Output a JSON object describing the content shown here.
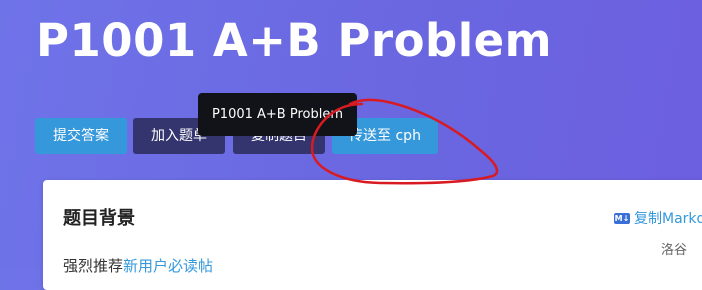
{
  "title": "P1001 A+B Problem",
  "buttons": {
    "submit": "提交答案",
    "add_to_list": "加入题单",
    "copy": "复制题目",
    "send_cph": "传送至 cph"
  },
  "tooltip": "P1001 A+B Problem",
  "card": {
    "section_title": "题目背景",
    "copy_markdown": "复制Markdown",
    "md_badge": "M↓",
    "source": "洛谷",
    "body_prefix": "强烈推荐",
    "body_link": "新用户必读帖"
  },
  "colors": {
    "accent": "#3498db",
    "dark_button": "#34346e",
    "annotation": "#d81b22"
  },
  "icons": {
    "markdown": "markdown-icon"
  }
}
